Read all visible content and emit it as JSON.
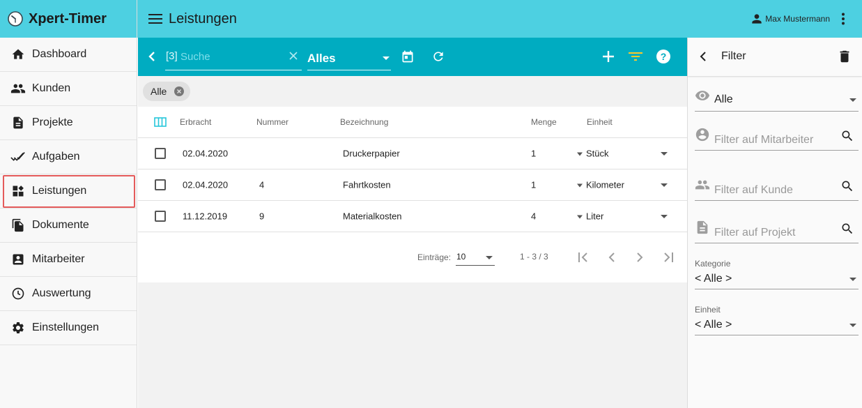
{
  "app": {
    "name": "Xpert-Timer"
  },
  "header": {
    "title": "Leistungen",
    "user_name": "Max Mustermann"
  },
  "sidebar": {
    "items": [
      {
        "label": "Dashboard",
        "icon": "home-icon"
      },
      {
        "label": "Kunden",
        "icon": "people-icon"
      },
      {
        "label": "Projekte",
        "icon": "document-icon"
      },
      {
        "label": "Aufgaben",
        "icon": "double-check-icon"
      },
      {
        "label": "Leistungen",
        "icon": "dashboard-widgets-icon",
        "active": true
      },
      {
        "label": "Dokumente",
        "icon": "documents-icon"
      },
      {
        "label": "Mitarbeiter",
        "icon": "contact-card-icon"
      },
      {
        "label": "Auswertung",
        "icon": "clock-icon"
      },
      {
        "label": "Einstellungen",
        "icon": "gear-icon"
      }
    ]
  },
  "toolbar": {
    "search_count": "[3]",
    "search_placeholder": "Suche",
    "filter_value": "Alles"
  },
  "chips": [
    {
      "label": "Alle"
    }
  ],
  "table": {
    "columns": [
      "Erbracht",
      "Nummer",
      "Bezeichnung",
      "Menge",
      "Einheit"
    ],
    "rows": [
      {
        "erbracht": "02.04.2020",
        "nummer": "",
        "bezeichnung": "Druckerpapier",
        "menge": "1",
        "einheit": "Stück"
      },
      {
        "erbracht": "02.04.2020",
        "nummer": "4",
        "bezeichnung": "Fahrtkosten",
        "menge": "1",
        "einheit": "Kilometer"
      },
      {
        "erbracht": "11.12.2019",
        "nummer": "9",
        "bezeichnung": "Materialkosten",
        "menge": "4",
        "einheit": "Liter"
      }
    ]
  },
  "paginator": {
    "label": "Einträge:",
    "page_size": "10",
    "range": "1 - 3 / 3"
  },
  "filter_panel": {
    "title": "Filter",
    "visibility_value": "Alle",
    "employee_placeholder": "Filter auf Mitarbeiter",
    "customer_placeholder": "Filter auf Kunde",
    "project_placeholder": "Filter auf Projekt",
    "category_label": "Kategorie",
    "category_value": "< Alle >",
    "unit_label": "Einheit",
    "unit_value": "< Alle >"
  },
  "colors": {
    "header_bg": "#4dd0e1",
    "toolbar_bg": "#00acc1",
    "filter_icon": "#ffca28",
    "active_outline": "#e45b5b"
  }
}
